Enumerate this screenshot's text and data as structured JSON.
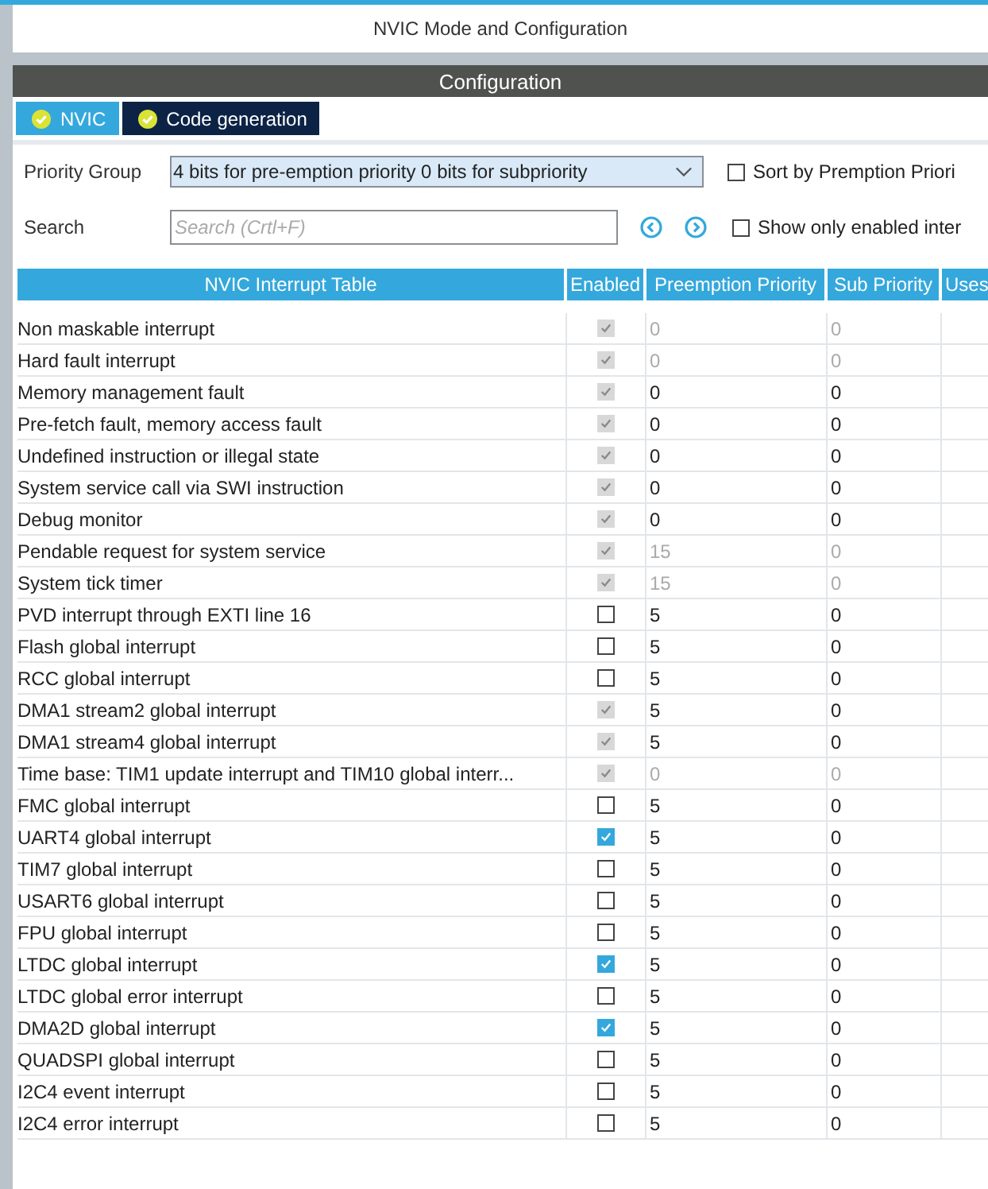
{
  "window": {
    "title": "NVIC Mode and Configuration"
  },
  "section": {
    "title": "Configuration"
  },
  "tabs": [
    {
      "label": "NVIC",
      "selected": true
    },
    {
      "label": "Code generation",
      "selected": false
    }
  ],
  "priority_group": {
    "label": "Priority Group",
    "value": "4 bits for pre-emption priority 0 bits for subpriority"
  },
  "sort_option": {
    "label": "Sort by Premption Priori",
    "checked": false
  },
  "search": {
    "label": "Search",
    "placeholder": "Search (Crtl+F)"
  },
  "show_enabled_option": {
    "label": "Show only enabled inter",
    "checked": false
  },
  "table": {
    "columns": [
      "NVIC Interrupt Table",
      "Enabled",
      "Preemption Priority",
      "Sub Priority",
      "Uses"
    ],
    "rows": [
      {
        "name": "Non maskable interrupt",
        "enabled": true,
        "enabled_locked": true,
        "preemption": "0",
        "sub": "0",
        "priority_locked": true
      },
      {
        "name": "Hard fault interrupt",
        "enabled": true,
        "enabled_locked": true,
        "preemption": "0",
        "sub": "0",
        "priority_locked": true
      },
      {
        "name": "Memory management fault",
        "enabled": true,
        "enabled_locked": true,
        "preemption": "0",
        "sub": "0",
        "priority_locked": false
      },
      {
        "name": "Pre-fetch fault, memory access fault",
        "enabled": true,
        "enabled_locked": true,
        "preemption": "0",
        "sub": "0",
        "priority_locked": false
      },
      {
        "name": "Undefined instruction or illegal state",
        "enabled": true,
        "enabled_locked": true,
        "preemption": "0",
        "sub": "0",
        "priority_locked": false
      },
      {
        "name": "System service call via SWI instruction",
        "enabled": true,
        "enabled_locked": true,
        "preemption": "0",
        "sub": "0",
        "priority_locked": false
      },
      {
        "name": "Debug monitor",
        "enabled": true,
        "enabled_locked": true,
        "preemption": "0",
        "sub": "0",
        "priority_locked": false
      },
      {
        "name": "Pendable request for system service",
        "enabled": true,
        "enabled_locked": true,
        "preemption": "15",
        "sub": "0",
        "priority_locked": true
      },
      {
        "name": "System tick timer",
        "enabled": true,
        "enabled_locked": true,
        "preemption": "15",
        "sub": "0",
        "priority_locked": true
      },
      {
        "name": "PVD interrupt through EXTI line 16",
        "enabled": false,
        "enabled_locked": false,
        "preemption": "5",
        "sub": "0",
        "priority_locked": false
      },
      {
        "name": "Flash global interrupt",
        "enabled": false,
        "enabled_locked": false,
        "preemption": "5",
        "sub": "0",
        "priority_locked": false
      },
      {
        "name": "RCC global interrupt",
        "enabled": false,
        "enabled_locked": false,
        "preemption": "5",
        "sub": "0",
        "priority_locked": false
      },
      {
        "name": "DMA1 stream2 global interrupt",
        "enabled": true,
        "enabled_locked": true,
        "preemption": "5",
        "sub": "0",
        "priority_locked": false
      },
      {
        "name": "DMA1 stream4 global interrupt",
        "enabled": true,
        "enabled_locked": true,
        "preemption": "5",
        "sub": "0",
        "priority_locked": false
      },
      {
        "name": "Time base: TIM1 update interrupt and TIM10 global interr...",
        "enabled": true,
        "enabled_locked": true,
        "preemption": "0",
        "sub": "0",
        "priority_locked": true
      },
      {
        "name": "FMC global interrupt",
        "enabled": false,
        "enabled_locked": false,
        "preemption": "5",
        "sub": "0",
        "priority_locked": false
      },
      {
        "name": "UART4 global interrupt",
        "enabled": true,
        "enabled_locked": false,
        "preemption": "5",
        "sub": "0",
        "priority_locked": false
      },
      {
        "name": "TIM7 global interrupt",
        "enabled": false,
        "enabled_locked": false,
        "preemption": "5",
        "sub": "0",
        "priority_locked": false
      },
      {
        "name": "USART6 global interrupt",
        "enabled": false,
        "enabled_locked": false,
        "preemption": "5",
        "sub": "0",
        "priority_locked": false
      },
      {
        "name": "FPU global interrupt",
        "enabled": false,
        "enabled_locked": false,
        "preemption": "5",
        "sub": "0",
        "priority_locked": false
      },
      {
        "name": "LTDC global interrupt",
        "enabled": true,
        "enabled_locked": false,
        "preemption": "5",
        "sub": "0",
        "priority_locked": false
      },
      {
        "name": "LTDC global error interrupt",
        "enabled": false,
        "enabled_locked": false,
        "preemption": "5",
        "sub": "0",
        "priority_locked": false
      },
      {
        "name": "DMA2D global interrupt",
        "enabled": true,
        "enabled_locked": false,
        "preemption": "5",
        "sub": "0",
        "priority_locked": false
      },
      {
        "name": "QUADSPI global interrupt",
        "enabled": false,
        "enabled_locked": false,
        "preemption": "5",
        "sub": "0",
        "priority_locked": false
      },
      {
        "name": "I2C4 event interrupt",
        "enabled": false,
        "enabled_locked": false,
        "preemption": "5",
        "sub": "0",
        "priority_locked": false
      },
      {
        "name": "I2C4 error interrupt",
        "enabled": false,
        "enabled_locked": false,
        "preemption": "5",
        "sub": "0",
        "priority_locked": false
      }
    ]
  }
}
